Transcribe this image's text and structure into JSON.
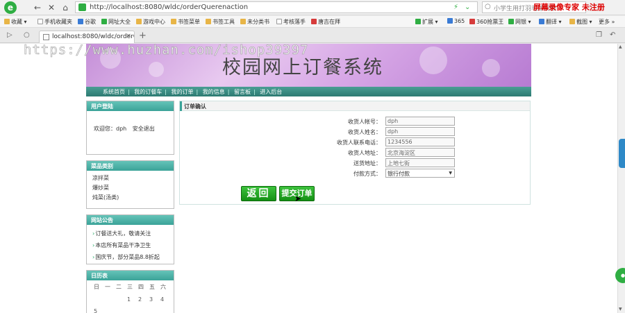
{
  "browser": {
    "url": "http://localhost:8080/wldc/orderQuerenaction",
    "search_placeholder": "小学生用打羽毛球视频",
    "recorder_watermark": "屏幕录像专家  未注册",
    "bookmarks": [
      "收藏",
      "手机收藏夹",
      "谷歌",
      "网址大全",
      "游戏中心",
      "书签菜单",
      "书签工具",
      "未分类书",
      "考核落手",
      "唐吉在拜"
    ],
    "right_tools": [
      "扩展",
      "365",
      "360抢票王",
      "网银",
      "翻译",
      "截图",
      "更多"
    ],
    "tab_title": "localhost:8080/wldc/orderQ...",
    "watermark": "https://www.huzhan.com/ishop39397"
  },
  "page": {
    "site_title": "校园网上订餐系统",
    "menu": [
      "系统首页",
      "我的订餐车",
      "我的订单",
      "我的信息",
      "留言板",
      "进入后台"
    ],
    "login_box": {
      "header": "用户登陆",
      "welcome": "欢迎您：dph",
      "logout": "安全退出"
    },
    "category_box": {
      "header": "菜品类别",
      "items": [
        "凉拌菜",
        "爆炒菜",
        "炖菜(汤类)"
      ]
    },
    "notice_box": {
      "header": "网站公告",
      "items": [
        "订餐送大礼，敬请关注",
        "本店所有菜品干净卫生",
        "国庆节，部分菜品8.8折起"
      ]
    },
    "calendar_box": {
      "header": "日历表",
      "weekdays": [
        "日",
        "一",
        "二",
        "三",
        "四",
        "五",
        "六"
      ],
      "days": [
        "",
        "",
        "",
        "1",
        "2",
        "3",
        "4",
        "5"
      ]
    },
    "order_confirm": {
      "header": "订单确认",
      "fields": [
        {
          "label": "收货人帐号：",
          "value": "dph"
        },
        {
          "label": "收货人姓名：",
          "value": "dph"
        },
        {
          "label": "收货人联系电话：",
          "value": "1234556"
        },
        {
          "label": "收货人地址：",
          "value": "北京海淀区"
        },
        {
          "label": "送货地址：",
          "value": "上地七街"
        }
      ],
      "payment": {
        "label": "付款方式：",
        "value": "银行付款"
      },
      "back_button": "返回",
      "submit_button": "提交订单"
    }
  }
}
